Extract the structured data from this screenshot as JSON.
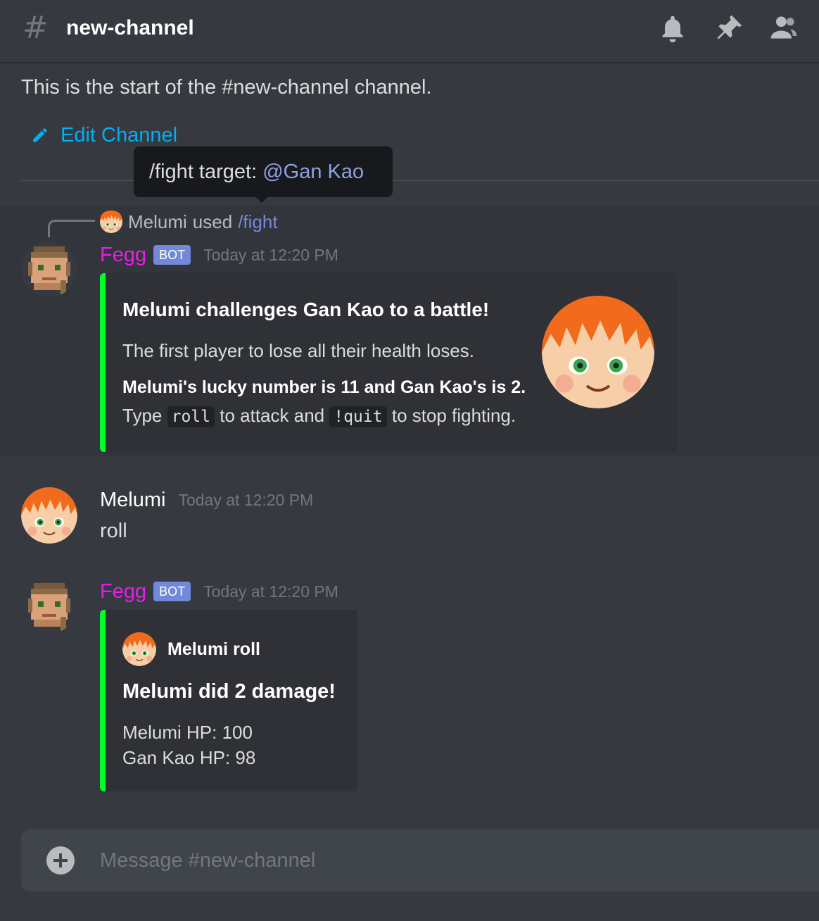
{
  "header": {
    "hash_symbol": "#",
    "channel_name": "new-channel",
    "icons": [
      "bell-icon",
      "pin-icon",
      "members-icon"
    ]
  },
  "channel_start": {
    "text": "This is the start of the #new-channel channel.",
    "edit_label": "Edit Channel"
  },
  "tooltip": {
    "prefix": "/fight target: ",
    "mention": "@Gan Kao"
  },
  "reply": {
    "user": "Melumi",
    "used": "used",
    "command": "/fight"
  },
  "messages": [
    {
      "author": "Fegg",
      "badge": "BOT",
      "timestamp": "Today at 12:20 PM",
      "author_color": "#e91ee8",
      "embed": {
        "title": "Melumi challenges Gan Kao to a battle!",
        "description": "The first player to lose all their health loses.",
        "lucky_line": "Melumi's lucky number is 11 and Gan Kao's is 2.",
        "type_word": "Type",
        "code1": "roll",
        "mid_text": "to attack and",
        "code2": "!quit",
        "end_text": "to stop fighting.",
        "bar_color": "#00ff2a"
      }
    },
    {
      "author": "Melumi",
      "timestamp": "Today at 12:20 PM",
      "content": "roll"
    },
    {
      "author": "Fegg",
      "badge": "BOT",
      "timestamp": "Today at 12:20 PM",
      "embed": {
        "author_name": "Melumi roll",
        "title": "Melumi did 2 damage!",
        "line1": "Melumi HP: 100",
        "line2": "Gan Kao HP: 98"
      }
    }
  ],
  "composer": {
    "placeholder": "Message #new-channel"
  }
}
